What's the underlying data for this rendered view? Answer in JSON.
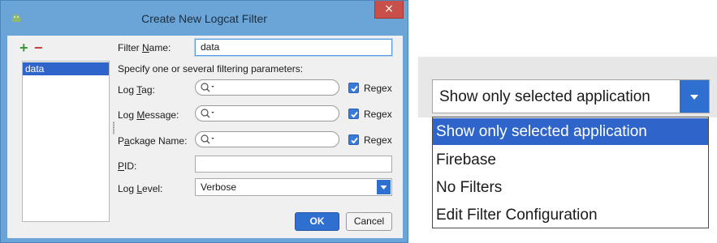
{
  "dialog": {
    "title": "Create New Logcat Filter",
    "close_glyph": "×",
    "add_glyph": "+",
    "remove_glyph": "−",
    "filters": [
      "data"
    ],
    "filter_name_label_pre": "Filter ",
    "filter_name_label_mn": "N",
    "filter_name_label_post": "ame:",
    "filter_name_value": "data",
    "hint": "Specify one or several filtering parameters:",
    "log_tag_pre": "Log ",
    "log_tag_mn": "T",
    "log_tag_post": "ag:",
    "log_message_pre": "Log ",
    "log_message_mn": "M",
    "log_message_post": "essage:",
    "package_name_pre": "P",
    "package_name_mn": "a",
    "package_name_post": "ckage Name:",
    "pid_pre": "",
    "pid_mn": "P",
    "pid_post": "ID:",
    "log_level_pre": "Log ",
    "log_level_mn": "L",
    "log_level_post": "evel:",
    "regex_label": "Regex",
    "log_level_value": "Verbose",
    "ok_label": "OK",
    "cancel_label": "Cancel",
    "regex_tag_checked": true,
    "regex_message_checked": true,
    "regex_package_checked": true
  },
  "dropdown": {
    "selected_value": "Show only selected application",
    "options": [
      "Show only selected application",
      "Firebase",
      "No Filters",
      "Edit Filter Configuration"
    ],
    "highlighted_index": 0
  },
  "colors": {
    "accent": "#2f65ca",
    "title_bar": "#6ba4d6",
    "close": "#c7504a",
    "add": "#3c9a3c",
    "remove": "#cf3a3a"
  },
  "icons": {
    "app": "android-icon",
    "close": "close-icon",
    "search": "search-icon",
    "check": "checkmark-icon",
    "arrow": "chevron-down-icon"
  }
}
